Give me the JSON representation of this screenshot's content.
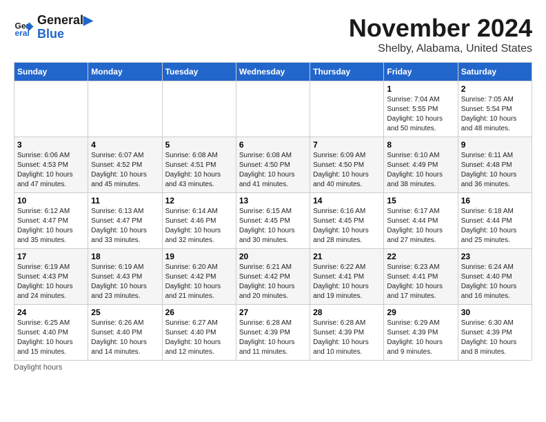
{
  "logo": {
    "line1": "General",
    "line2": "Blue"
  },
  "title": "November 2024",
  "location": "Shelby, Alabama, United States",
  "days_of_week": [
    "Sunday",
    "Monday",
    "Tuesday",
    "Wednesday",
    "Thursday",
    "Friday",
    "Saturday"
  ],
  "weeks": [
    [
      {
        "day": "",
        "info": ""
      },
      {
        "day": "",
        "info": ""
      },
      {
        "day": "",
        "info": ""
      },
      {
        "day": "",
        "info": ""
      },
      {
        "day": "",
        "info": ""
      },
      {
        "day": "1",
        "info": "Sunrise: 7:04 AM\nSunset: 5:55 PM\nDaylight: 10 hours and 50 minutes."
      },
      {
        "day": "2",
        "info": "Sunrise: 7:05 AM\nSunset: 5:54 PM\nDaylight: 10 hours and 48 minutes."
      }
    ],
    [
      {
        "day": "3",
        "info": "Sunrise: 6:06 AM\nSunset: 4:53 PM\nDaylight: 10 hours and 47 minutes."
      },
      {
        "day": "4",
        "info": "Sunrise: 6:07 AM\nSunset: 4:52 PM\nDaylight: 10 hours and 45 minutes."
      },
      {
        "day": "5",
        "info": "Sunrise: 6:08 AM\nSunset: 4:51 PM\nDaylight: 10 hours and 43 minutes."
      },
      {
        "day": "6",
        "info": "Sunrise: 6:08 AM\nSunset: 4:50 PM\nDaylight: 10 hours and 41 minutes."
      },
      {
        "day": "7",
        "info": "Sunrise: 6:09 AM\nSunset: 4:50 PM\nDaylight: 10 hours and 40 minutes."
      },
      {
        "day": "8",
        "info": "Sunrise: 6:10 AM\nSunset: 4:49 PM\nDaylight: 10 hours and 38 minutes."
      },
      {
        "day": "9",
        "info": "Sunrise: 6:11 AM\nSunset: 4:48 PM\nDaylight: 10 hours and 36 minutes."
      }
    ],
    [
      {
        "day": "10",
        "info": "Sunrise: 6:12 AM\nSunset: 4:47 PM\nDaylight: 10 hours and 35 minutes."
      },
      {
        "day": "11",
        "info": "Sunrise: 6:13 AM\nSunset: 4:47 PM\nDaylight: 10 hours and 33 minutes."
      },
      {
        "day": "12",
        "info": "Sunrise: 6:14 AM\nSunset: 4:46 PM\nDaylight: 10 hours and 32 minutes."
      },
      {
        "day": "13",
        "info": "Sunrise: 6:15 AM\nSunset: 4:45 PM\nDaylight: 10 hours and 30 minutes."
      },
      {
        "day": "14",
        "info": "Sunrise: 6:16 AM\nSunset: 4:45 PM\nDaylight: 10 hours and 28 minutes."
      },
      {
        "day": "15",
        "info": "Sunrise: 6:17 AM\nSunset: 4:44 PM\nDaylight: 10 hours and 27 minutes."
      },
      {
        "day": "16",
        "info": "Sunrise: 6:18 AM\nSunset: 4:44 PM\nDaylight: 10 hours and 25 minutes."
      }
    ],
    [
      {
        "day": "17",
        "info": "Sunrise: 6:19 AM\nSunset: 4:43 PM\nDaylight: 10 hours and 24 minutes."
      },
      {
        "day": "18",
        "info": "Sunrise: 6:19 AM\nSunset: 4:43 PM\nDaylight: 10 hours and 23 minutes."
      },
      {
        "day": "19",
        "info": "Sunrise: 6:20 AM\nSunset: 4:42 PM\nDaylight: 10 hours and 21 minutes."
      },
      {
        "day": "20",
        "info": "Sunrise: 6:21 AM\nSunset: 4:42 PM\nDaylight: 10 hours and 20 minutes."
      },
      {
        "day": "21",
        "info": "Sunrise: 6:22 AM\nSunset: 4:41 PM\nDaylight: 10 hours and 19 minutes."
      },
      {
        "day": "22",
        "info": "Sunrise: 6:23 AM\nSunset: 4:41 PM\nDaylight: 10 hours and 17 minutes."
      },
      {
        "day": "23",
        "info": "Sunrise: 6:24 AM\nSunset: 4:40 PM\nDaylight: 10 hours and 16 minutes."
      }
    ],
    [
      {
        "day": "24",
        "info": "Sunrise: 6:25 AM\nSunset: 4:40 PM\nDaylight: 10 hours and 15 minutes."
      },
      {
        "day": "25",
        "info": "Sunrise: 6:26 AM\nSunset: 4:40 PM\nDaylight: 10 hours and 14 minutes."
      },
      {
        "day": "26",
        "info": "Sunrise: 6:27 AM\nSunset: 4:40 PM\nDaylight: 10 hours and 12 minutes."
      },
      {
        "day": "27",
        "info": "Sunrise: 6:28 AM\nSunset: 4:39 PM\nDaylight: 10 hours and 11 minutes."
      },
      {
        "day": "28",
        "info": "Sunrise: 6:28 AM\nSunset: 4:39 PM\nDaylight: 10 hours and 10 minutes."
      },
      {
        "day": "29",
        "info": "Sunrise: 6:29 AM\nSunset: 4:39 PM\nDaylight: 10 hours and 9 minutes."
      },
      {
        "day": "30",
        "info": "Sunrise: 6:30 AM\nSunset: 4:39 PM\nDaylight: 10 hours and 8 minutes."
      }
    ]
  ],
  "footer": "Daylight hours"
}
